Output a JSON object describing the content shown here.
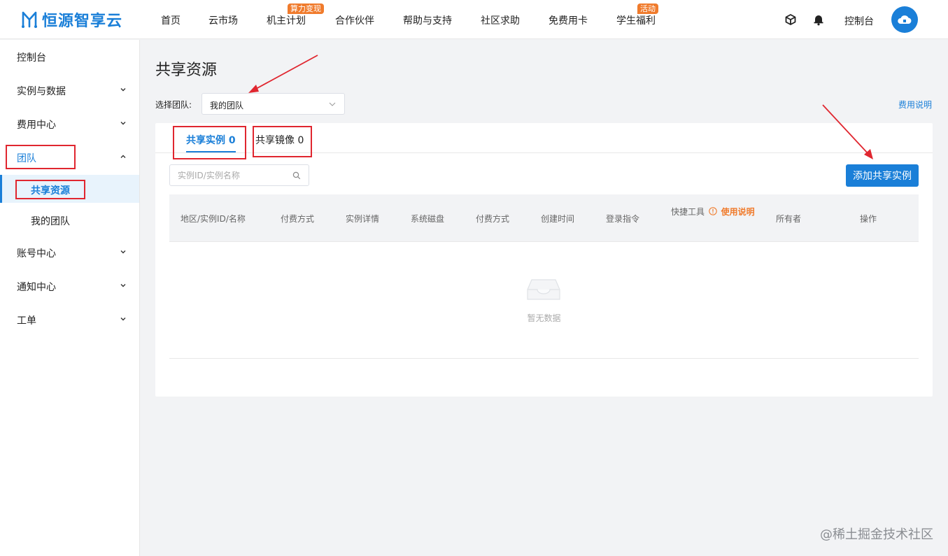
{
  "header": {
    "logo_text": "恒源智享云",
    "nav": [
      {
        "label": "首页"
      },
      {
        "label": "云市场"
      },
      {
        "label": "机主计划",
        "badge": "算力变现"
      },
      {
        "label": "合作伙伴"
      },
      {
        "label": "帮助与支持"
      },
      {
        "label": "社区求助"
      },
      {
        "label": "免费用卡"
      },
      {
        "label": "学生福利",
        "badge": "活动"
      }
    ],
    "console_label": "控制台",
    "icons": [
      "cube-icon",
      "bell-icon",
      "cloud-avatar-icon"
    ]
  },
  "sidebar": {
    "items": [
      {
        "label": "控制台"
      },
      {
        "label": "实例与数据"
      },
      {
        "label": "费用中心"
      },
      {
        "label": "团队"
      },
      {
        "label": "共享资源"
      },
      {
        "label": "我的团队"
      },
      {
        "label": "账号中心"
      },
      {
        "label": "通知中心"
      },
      {
        "label": "工单"
      }
    ]
  },
  "main": {
    "page_title": "共享资源",
    "team_label": "选择团队:",
    "team_value": "我的团队",
    "fee_link": "费用说明",
    "tabs": [
      {
        "label": "共享实例 0"
      },
      {
        "label": "共享镜像 0"
      }
    ],
    "search_placeholder": "实例ID/实例名称",
    "add_button": "添加共享实例",
    "columns": [
      "地区/实例ID/名称",
      "付费方式",
      "实例详情",
      "系统磁盘",
      "付费方式",
      "创建时间",
      "登录指令",
      "快捷工具",
      "所有者",
      "操作"
    ],
    "help_link": "使用说明",
    "empty_text": "暂无数据"
  },
  "watermark": "@稀土掘金技术社区",
  "colors": {
    "accent": "#1a7fd8",
    "badge": "#f07b2c",
    "annotation": "#e0262f"
  }
}
